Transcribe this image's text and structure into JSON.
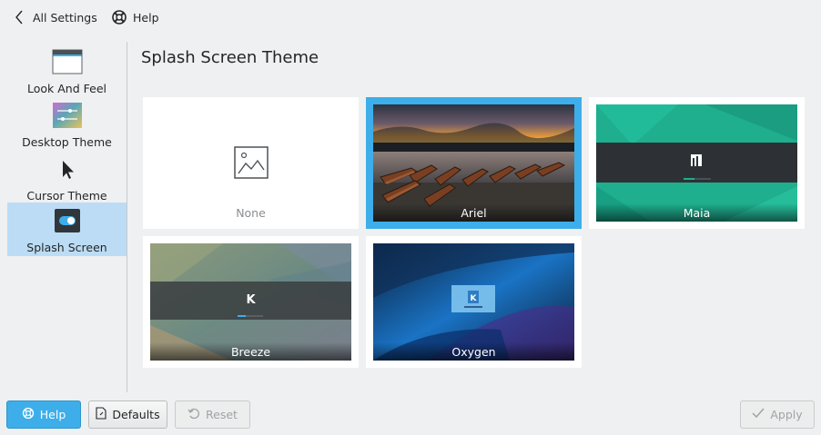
{
  "topbar": {
    "back_label": "All Settings",
    "help_label": "Help"
  },
  "sidebar": {
    "items": [
      {
        "label": "Look And Feel",
        "icon": "window-icon"
      },
      {
        "label": "Desktop Theme",
        "icon": "desktop-theme-icon"
      },
      {
        "label": "Cursor Theme",
        "icon": "cursor-icon"
      },
      {
        "label": "Splash Screen",
        "icon": "toggle-icon",
        "selected": true
      }
    ]
  },
  "main": {
    "title": "Splash Screen Theme",
    "themes": [
      {
        "name": "None",
        "selected": false
      },
      {
        "name": "Ariel",
        "selected": true
      },
      {
        "name": "Maia",
        "selected": false
      },
      {
        "name": "Breeze",
        "selected": false
      },
      {
        "name": "Oxygen",
        "selected": false
      }
    ]
  },
  "footer": {
    "help_label": "Help",
    "defaults_label": "Defaults",
    "reset_label": "Reset",
    "apply_label": "Apply"
  },
  "colors": {
    "accent": "#3daee9",
    "selection": "#bcdcf5",
    "background": "#eff0f1"
  }
}
